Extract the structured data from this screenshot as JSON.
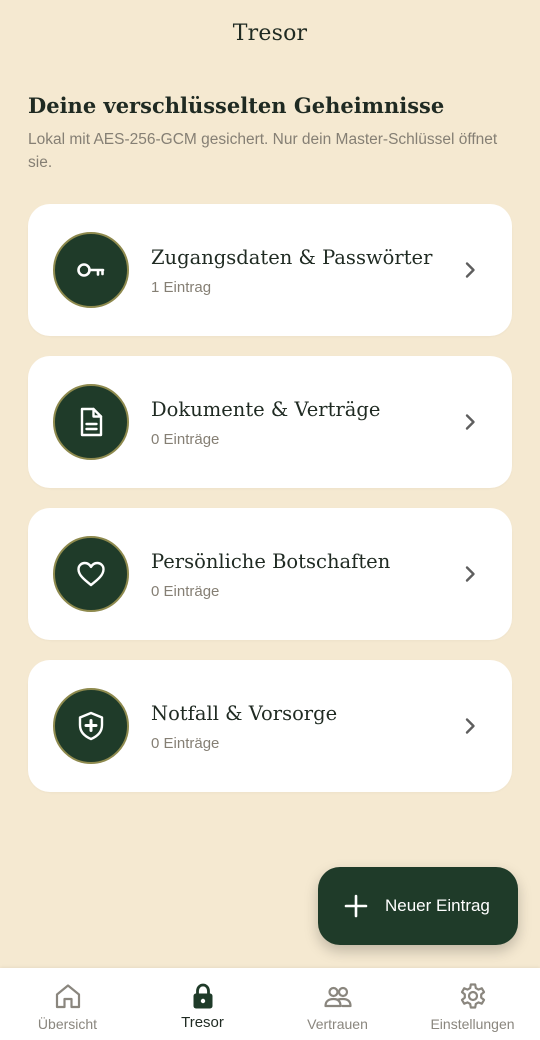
{
  "appbar": {
    "title": "Tresor"
  },
  "intro": {
    "heading": "Deine verschlüsselten Geheimnisse",
    "description": "Lokal mit AES-256-GCM gesichert. Nur dein Master-Schlüssel öffnet sie."
  },
  "categories": [
    {
      "title": "Zugangsdaten & Passwörter",
      "count": "1 Eintrag",
      "icon": "key-icon"
    },
    {
      "title": "Dokumente & Verträge",
      "count": "0 Einträge",
      "icon": "document-icon"
    },
    {
      "title": "Persönliche Botschaften",
      "count": "0 Einträge",
      "icon": "heart-icon"
    },
    {
      "title": "Notfall & Vorsorge",
      "count": "0 Einträge",
      "icon": "shield-plus-icon"
    }
  ],
  "fab": {
    "label": "Neuer Eintrag",
    "icon": "plus-icon"
  },
  "nav": {
    "items": [
      {
        "label": "Übersicht",
        "icon": "home-icon"
      },
      {
        "label": "Tresor",
        "icon": "lock-icon",
        "active": true
      },
      {
        "label": "Vertrauen",
        "icon": "people-icon"
      },
      {
        "label": "Einstellungen",
        "icon": "gear-icon"
      }
    ]
  },
  "colors": {
    "background": "#F5E9D1",
    "accent_dark_green": "#1F3B29",
    "icon_ring": "#8E8A4E",
    "muted_text": "#857F74"
  }
}
